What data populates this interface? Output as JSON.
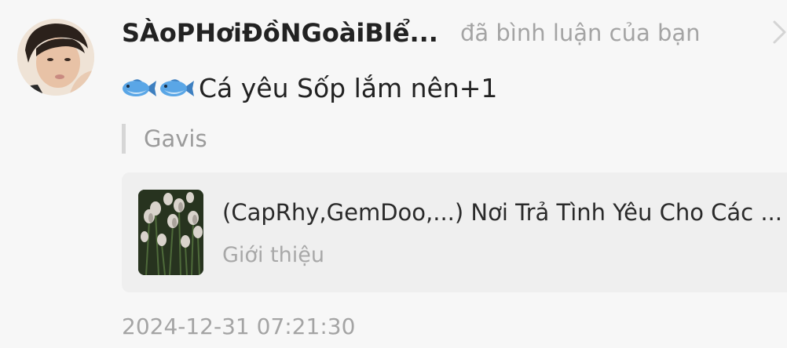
{
  "notification": {
    "username": "SÀoPHơiĐồNGoàiBlể...",
    "action": "đã bình luận của bạn",
    "comment": {
      "emoji_icons": [
        "fish-icon",
        "fish-icon"
      ],
      "text": "Cá yêu Sốp lắm nên+1"
    },
    "quoted": "Gavis",
    "book": {
      "title": "(CapRhy,GemDoo,...) Nơi Trả Tình Yêu Cho Các ...",
      "subtitle": "Giới thiệu"
    },
    "timestamp": "2024-12-31 07:21:30"
  },
  "colors": {
    "background": "#f7f7f7",
    "card": "#efefef",
    "muted_text": "#a4a4a4",
    "primary_text": "#222222"
  }
}
